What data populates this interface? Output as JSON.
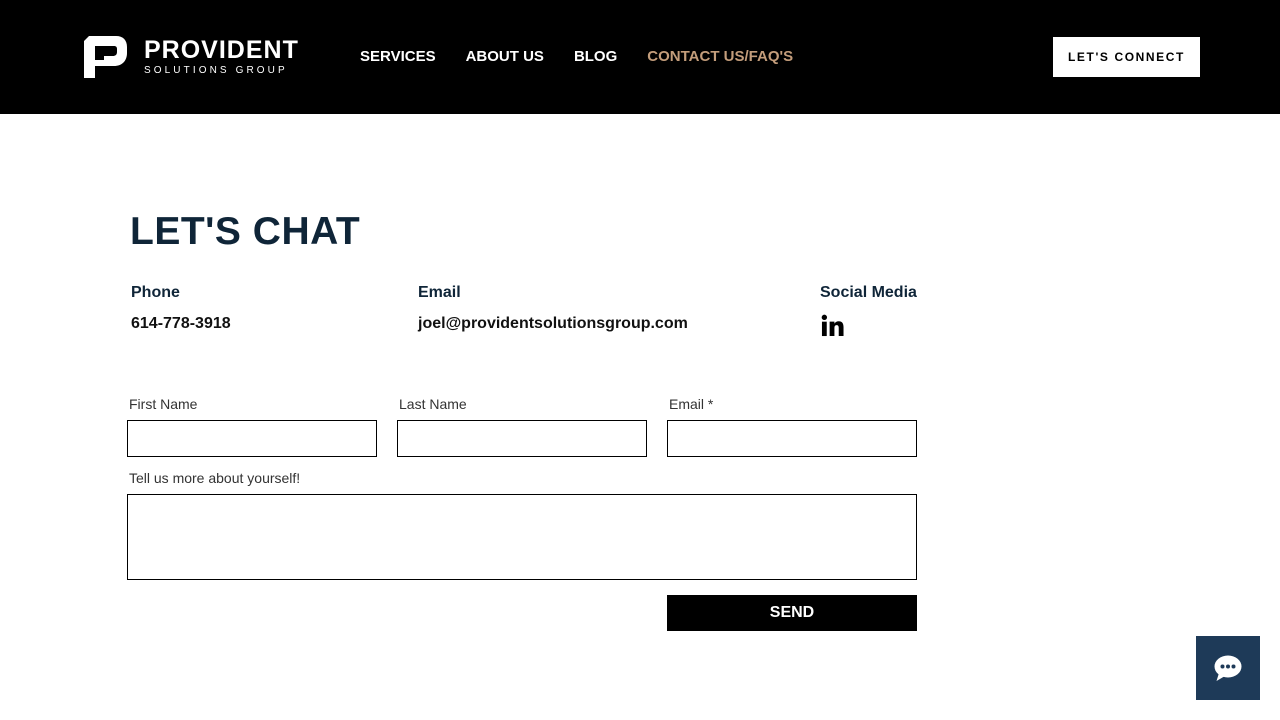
{
  "header": {
    "logo": {
      "title": "PROVIDENT",
      "subtitle": "SOLUTIONS GROUP"
    },
    "nav": [
      {
        "label": "SERVICES"
      },
      {
        "label": "ABOUT US"
      },
      {
        "label": "BLOG"
      },
      {
        "label": "CONTACT US/FAQ'S",
        "active": true
      }
    ],
    "cta_label": "LET'S CONNECT"
  },
  "main": {
    "title": "LET'S CHAT",
    "contact": {
      "phone_heading": "Phone",
      "phone_value": "614-778-3918",
      "email_heading": "Email",
      "email_value": "joel@providentsolutionsgroup.com",
      "social_heading": "Social Media",
      "social_icons": [
        "linkedin-icon"
      ]
    },
    "form": {
      "first_name_label": "First Name",
      "first_name_value": "",
      "last_name_label": "Last Name",
      "last_name_value": "",
      "email_label": "Email *",
      "email_value": "",
      "message_label": "Tell us more about yourself!",
      "message_value": "",
      "send_label": "SEND"
    }
  },
  "chat_widget": {
    "icon": "chat-bubble-icon"
  },
  "colors": {
    "header_bg": "#000000",
    "nav_active": "#c39d7b",
    "heading": "#0f2538",
    "chat_widget_bg": "#1e3a58"
  }
}
